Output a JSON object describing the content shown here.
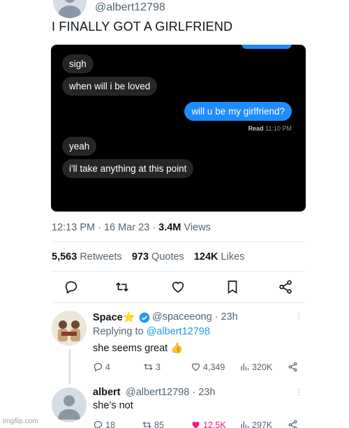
{
  "tweet": {
    "handle": "@albert12798",
    "text": "I FINALLY GOT A GIRLFRIEND",
    "time": "12:13 PM · 16 Mar 23 · ",
    "views_count": "3.4M",
    "views_label": " Views",
    "retweets_count": "5,563",
    "retweets_label": " Retweets",
    "quotes_count": "973",
    "quotes_label": " Quotes",
    "likes_count": "124K",
    "likes_label": " Likes"
  },
  "chat": {
    "messages": [
      {
        "text": "sigh",
        "side": "in"
      },
      {
        "text": "when will i be loved",
        "side": "in"
      },
      {
        "text": "will u be my girlfriend?",
        "side": "out"
      },
      {
        "text": "yeah",
        "side": "in"
      },
      {
        "text": "i'll take anything at this point",
        "side": "in"
      }
    ],
    "read_label": "Read",
    "read_time": " 11:10 PM"
  },
  "actions": {
    "icons": [
      "reply-icon",
      "retweet-icon",
      "like-icon",
      "bookmark-icon",
      "share-icon"
    ]
  },
  "replies": [
    {
      "name": "Space",
      "name_emoji": "⭐",
      "handle_time": "@spaceeong · 23h",
      "replying_prefix": "Replying to ",
      "replying_to": "@albert12798",
      "text": "she seems great 👍",
      "stats": {
        "replies": "4",
        "retweets": "3",
        "likes": "4,349",
        "views": "320K"
      }
    },
    {
      "name": "albert",
      "handle_time": "@albert12798 · 23h",
      "text": "she’s not",
      "stats": {
        "replies": "18",
        "retweets": "85",
        "likes": "12.5K",
        "views": "297K"
      }
    }
  ],
  "watermark": "imgflip.com",
  "colors": {
    "accent": "#1d9bf0",
    "imessage_blue": "#1f8bff",
    "like_pink": "#f91880",
    "verified": "#1d9bf0",
    "star": "#ffc107"
  }
}
